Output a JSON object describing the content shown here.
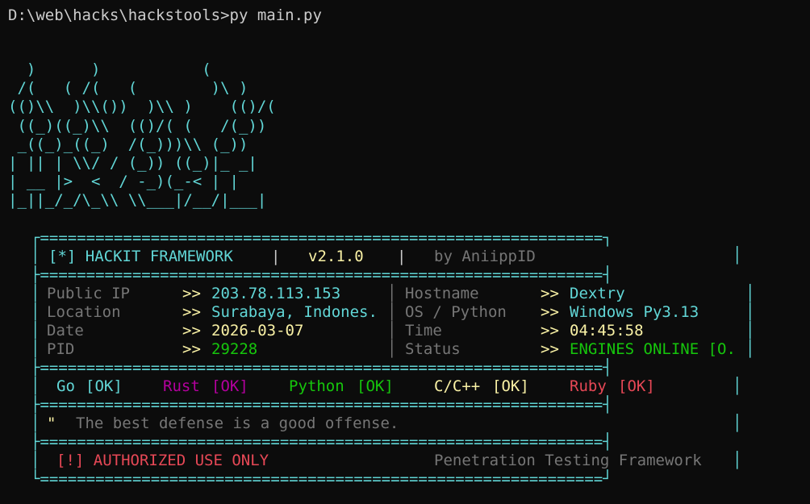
{
  "terminal": {
    "prompt": "D:\\web\\hacks\\hackstools>py main.py",
    "ascii_art": "  )      )           (\n /(   ( /(   (        )\\ )\n(()\\\\  )\\\\())  )\\\\ )    (()/(\n ((_)((_)\\\\  (()/( (   /(_))\n _((_)_((_)  /(_)))\\\\ (_))\n| || | \\\\/ / (_)) ((_)|_ _|\n| __ |>  <  / -_)(_-< | |\n|_||_/_/\\_\\\\ \\\\___|/__/|___|"
  },
  "banner": {
    "border_top": "┌=============================================================┐",
    "border_mid": "├=============================================================┤",
    "border_bottom": "└=============================================================┘",
    "title": "[*] HACKIT FRAMEWORK",
    "sep": "|",
    "version": "v2.1.0",
    "author": "by AniippID",
    "info_left": [
      {
        "label": "Public IP",
        "arrow": ">>",
        "value": "203.78.113.153"
      },
      {
        "label": "Location",
        "arrow": ">>",
        "value": "Surabaya, Indones."
      },
      {
        "label": "Date",
        "arrow": ">>",
        "value": "2026-03-07"
      },
      {
        "label": "PID",
        "arrow": ">>",
        "value": "29228"
      }
    ],
    "info_right": [
      {
        "label": "Hostname",
        "arrow": ">>",
        "value": "Dextry"
      },
      {
        "label": "OS / Python",
        "arrow": ">>",
        "value": "Windows Py3.13"
      },
      {
        "label": "Time",
        "arrow": ">>",
        "value": "04:45:58"
      },
      {
        "label": "Status",
        "arrow": ">>",
        "value": "ENGINES ONLINE [O."
      }
    ],
    "engines": [
      {
        "name": "Go",
        "status": "[OK]"
      },
      {
        "name": "Rust",
        "status": "[OK]"
      },
      {
        "name": "Python",
        "status": "[OK]"
      },
      {
        "name": "C/C++",
        "status": "[OK]"
      },
      {
        "name": "Ruby",
        "status": "[OK]"
      }
    ],
    "quote_mark": "\"",
    "quote": "The best defense is a good offense.",
    "warning": "[!] AUTHORIZED USE ONLY",
    "tagline": "Penetration Testing Framework"
  },
  "colors": {
    "background": "#0c0c0c",
    "cyan": "#61d6d6",
    "yellow": "#f9f1a5",
    "green": "#16c60c",
    "magenta": "#b4009e",
    "red": "#e74856",
    "gray": "#767676"
  }
}
